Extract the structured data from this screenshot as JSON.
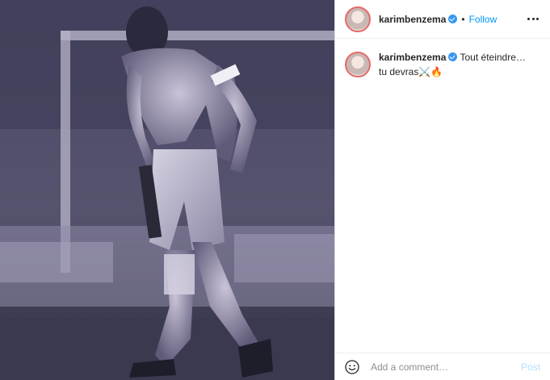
{
  "post": {
    "author": "karimbenzema",
    "follow_label": "Follow",
    "separator": "•",
    "caption_text": "Tout éteindre… tu devras⚔️🔥"
  },
  "comment_box": {
    "placeholder": "Add a comment…",
    "post_label": "Post"
  },
  "icons": {
    "verified": "verified-badge-icon",
    "more": "more-options-icon",
    "emoji": "emoji-smiley-icon"
  },
  "colors": {
    "accent_link": "#0095f6",
    "verified": "#3897f0",
    "post_disabled": "#b2dffc",
    "photo_tint": "#3b3a55"
  }
}
